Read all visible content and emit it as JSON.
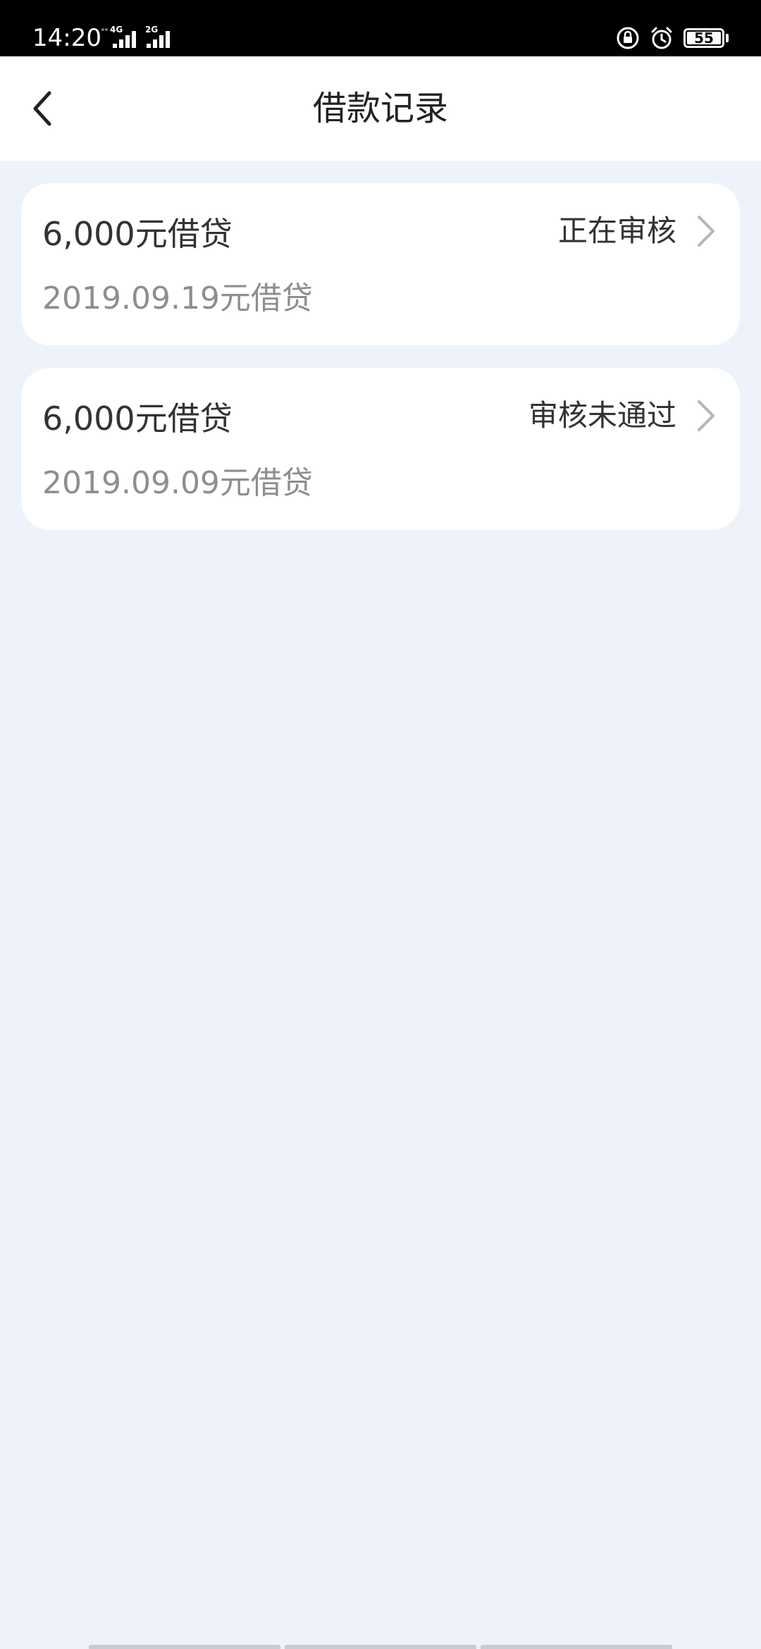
{
  "status_bar": {
    "time": "14:20",
    "network_1": "4G",
    "network_2": "2G",
    "battery": "55",
    "icons": [
      "lock-rotation-icon",
      "alarm-icon",
      "battery-icon"
    ]
  },
  "header": {
    "title": "借款记录",
    "back_icon": "chevron-left-icon"
  },
  "records": [
    {
      "amount": "6,000元借贷",
      "date": "2019.09.19元借贷",
      "status": "正在审核"
    },
    {
      "amount": "6,000元借贷",
      "date": "2019.09.09元借贷",
      "status": "审核未通过"
    }
  ],
  "colors": {
    "background": "#EEF2FA",
    "card": "#FFFFFF",
    "text_primary": "#333333",
    "text_secondary": "#8E8E8E",
    "chevron": "#B5B5B5"
  }
}
